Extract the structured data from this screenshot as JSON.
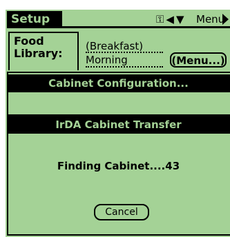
{
  "header": {
    "title": "Setup",
    "menu_label": "Menu"
  },
  "form": {
    "food_library_label": "Food\nLibrary:",
    "meal_line1": "(Breakfast)",
    "meal_line2": "Morning",
    "menu_button_label": "(Menu...)"
  },
  "dialogs": {
    "config_title": "Cabinet Configuration...",
    "irda_title": "IrDA Cabinet Transfer",
    "status_text": "Finding Cabinet....43",
    "cancel_label": "Cancel"
  },
  "colors": {
    "lcd_green": "#a4d296",
    "ink": "#000000"
  },
  "icons": [
    "key-icon",
    "left-arrow-icon",
    "down-arrow-icon",
    "right-arrow-icon"
  ]
}
